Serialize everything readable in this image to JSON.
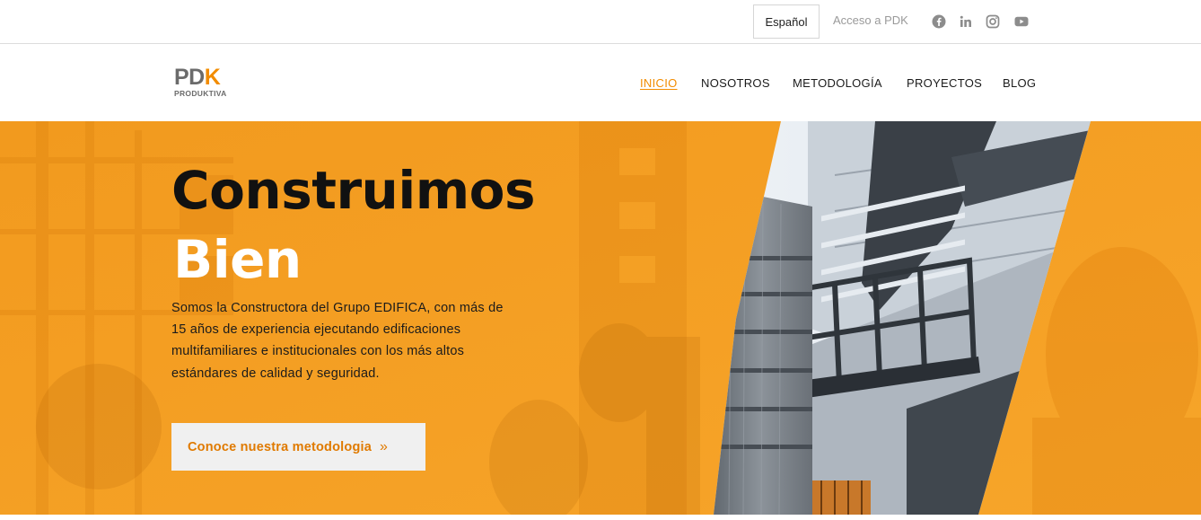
{
  "topbar": {
    "language_label": "Español",
    "access_label": "Acceso a PDK",
    "social_icons": [
      "facebook-icon",
      "linkedin-icon",
      "instagram-icon",
      "youtube-icon"
    ]
  },
  "logo": {
    "main_prefix": "PD",
    "main_accent": "K",
    "tagline": "PRODUKTIVA"
  },
  "nav": {
    "items": [
      {
        "label": "INICIO",
        "active": true
      },
      {
        "label": "NOSOTROS",
        "active": false
      },
      {
        "label": "METODOLOGÍA",
        "active": false
      },
      {
        "label": "PROYECTOS",
        "active": false
      },
      {
        "label": "BLOG",
        "active": false
      }
    ]
  },
  "hero": {
    "title_line1": "Construimos",
    "title_line2": "Bien",
    "description": "Somos la Constructora del Grupo EDIFICA, con más de 15 años de experiencia ejecutando edificaciones multifamiliares e institucionales con los más altos estándares de calidad y seguridad.",
    "cta_label": "Conoce nuestra metodologia",
    "cta_icon": "double-chevron-right-icon"
  },
  "colors": {
    "accent": "#f28c00",
    "hero_orange": "#f5a623",
    "cta_text": "#e07a00",
    "muted_text": "#9a9a9a"
  }
}
